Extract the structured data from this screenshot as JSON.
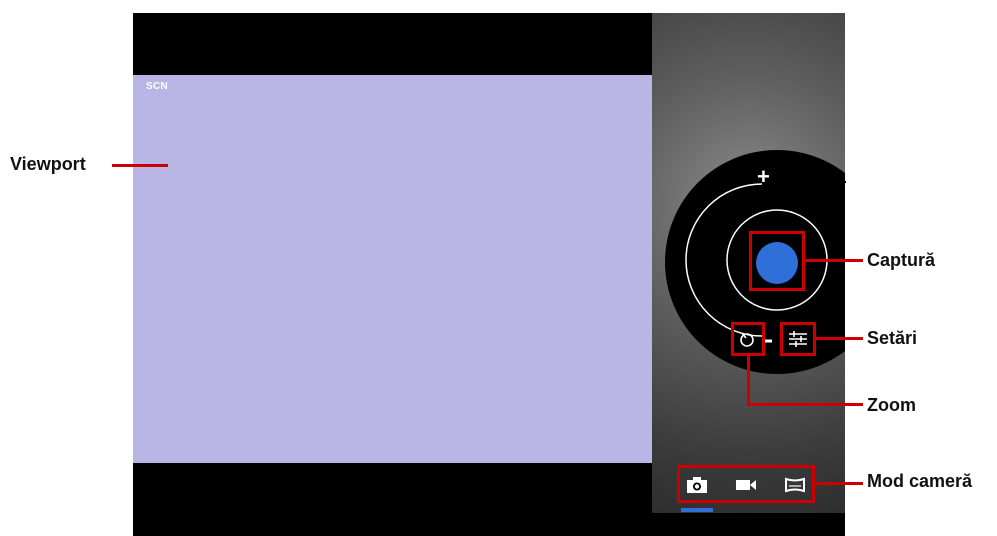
{
  "viewport": {
    "mode_label": "SCN",
    "color": "#b9b5e4"
  },
  "controls": {
    "zoom_plus": "+",
    "capture_color": "#2f6fd8",
    "accent": "#cc0000"
  },
  "mode_bar": {
    "active_indicator_color": "#2f6fd8"
  },
  "annotations": {
    "viewport": "Viewport",
    "capture": "Captură",
    "settings": "Setări",
    "zoom": "Zoom",
    "camera_mode": "Mod cameră"
  }
}
